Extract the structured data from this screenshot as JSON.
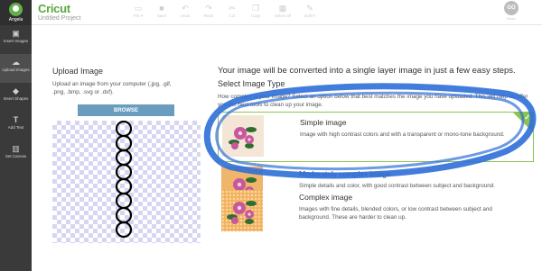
{
  "user": {
    "name": "Angela",
    "icon": "user-avatar-icon"
  },
  "app": {
    "logo": "Cricut",
    "project_title": "Untitled Project"
  },
  "toolbar": {
    "file": "File ▾",
    "save": "Save",
    "undo": "Undo",
    "redo": "Redo",
    "cut": "Cut",
    "copy": "Copy",
    "select_all": "Select All",
    "edit": "Edit ▾",
    "go": "GO",
    "go_label": "Make"
  },
  "sidebar": {
    "items": [
      {
        "label": "Insert Images",
        "icon": "image-icon"
      },
      {
        "label": "Upload Images",
        "icon": "cloud-upload-icon"
      },
      {
        "label": "Insert Shapes",
        "icon": "shapes-icon"
      },
      {
        "label": "Add Text",
        "icon": "text-icon"
      },
      {
        "label": "Set Canvas",
        "icon": "canvas-icon"
      }
    ]
  },
  "upload": {
    "title": "Upload Image",
    "description": "Upload an image from your computer (.jpg, .gif, .png, .bmp, .svg or .dxf).",
    "browse_label": "BROWSE"
  },
  "image_type": {
    "intro": "Your image will be converted into a single layer image in just a few easy steps.",
    "heading": "Select Image Type",
    "question": "How complex is your image? Select an option below that best matches the image you have uploaded. This will help us offer you the best tools to clean up your image.",
    "options": [
      {
        "title": "Simple image",
        "description": "Image with high contrast colors and with a transparent or mono-tone background.",
        "selected": true
      },
      {
        "title": "Moderately complex image",
        "description": "Simple details and color, with good contrast between subject and background.",
        "selected": false
      },
      {
        "title": "Complex image",
        "description": "Images with fine details, blended colors, or low contrast between subject and background. These are harder to clean up.",
        "selected": false
      }
    ]
  },
  "colors": {
    "accent_green": "#8cc44f",
    "browse_blue": "#6a9cc0",
    "annotation_blue": "#2f6fd8",
    "sidebar_dark": "#3a3a3a"
  }
}
